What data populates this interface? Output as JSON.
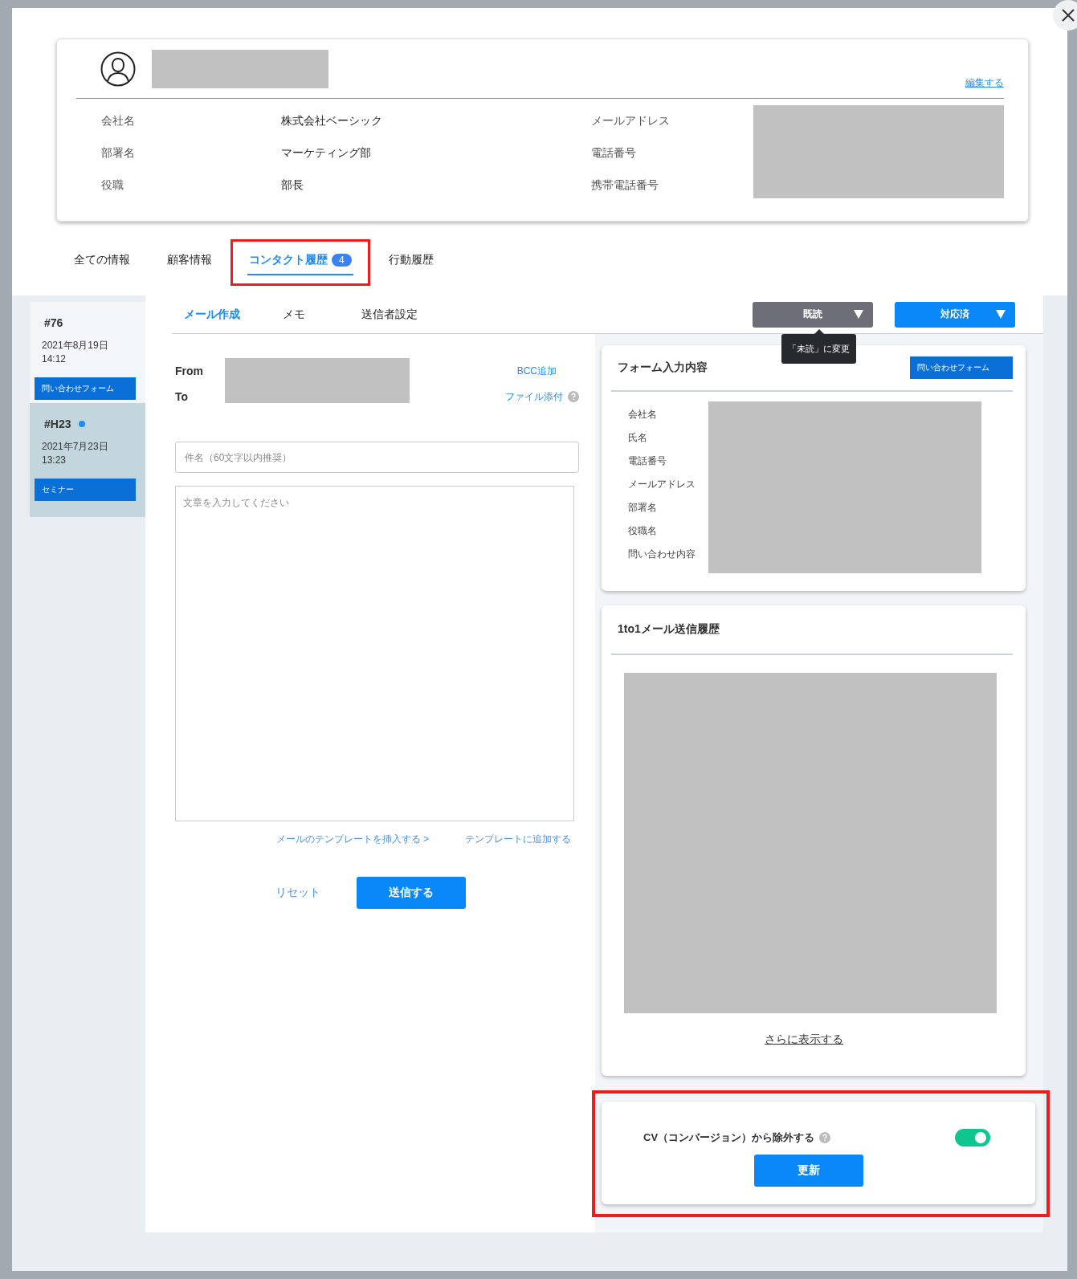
{
  "profile": {
    "edit_link": "編集する",
    "fields": [
      {
        "label": "会社名",
        "value": "株式会社ベーシック"
      },
      {
        "label": "部署名",
        "value": "マーケティング部"
      },
      {
        "label": "役職",
        "value": "部長"
      }
    ],
    "contact_labels": [
      "メールアドレス",
      "電話番号",
      "携帯電話番号"
    ]
  },
  "tabs": [
    {
      "label": "全ての情報",
      "selected": false,
      "highlighted": false
    },
    {
      "label": "顧客情報",
      "selected": false,
      "highlighted": false
    },
    {
      "label": "コンタクト履歴",
      "badge": "4",
      "selected": true,
      "highlighted": true
    },
    {
      "label": "行動履歴",
      "selected": false,
      "highlighted": false
    }
  ],
  "contacts": [
    {
      "number": "#76",
      "date": "2021年8月19日",
      "time": "14:12",
      "tag": "問い合わせフォーム",
      "selected": false,
      "unread": false
    },
    {
      "number": "#H23",
      "date": "2021年7月23日",
      "time": "13:23",
      "tag": "セミナー",
      "selected": true,
      "unread": true
    }
  ],
  "compose_tabs": [
    {
      "label": "メール作成",
      "selected": true
    },
    {
      "label": "メモ",
      "selected": false
    },
    {
      "label": "送信者設定",
      "selected": false
    }
  ],
  "status_dropdowns": [
    {
      "label": "既読",
      "color": "#6c6f78",
      "tooltip": "「未読」に変更"
    },
    {
      "label": "対応済",
      "color": "#0a88f7"
    }
  ],
  "compose": {
    "from_label": "From",
    "to_label": "To",
    "bcc_link": "BCC追加",
    "attach_link": "ファイル添付",
    "subject_placeholder": "件名（60文字以内推奨）",
    "body_placeholder": "文章を入力してください",
    "template_insert_link": "メールのテンプレートを挿入する >",
    "template_add_link": "テンプレートに追加する",
    "reset": "リセット",
    "send": "送信する"
  },
  "form_panel": {
    "title": "フォーム入力内容",
    "tag": "問い合わせフォーム",
    "fields": [
      "会社名",
      "氏名",
      "電話番号",
      "メールアドレス",
      "部署名",
      "役職名",
      "問い合わせ内容"
    ]
  },
  "history_panel": {
    "title": "1to1メール送信履歴",
    "more_link": "さらに表示する"
  },
  "cv_panel": {
    "label": "CV（コンバージョン）から除外する",
    "on": true,
    "highlighted": true,
    "button": "更新"
  }
}
